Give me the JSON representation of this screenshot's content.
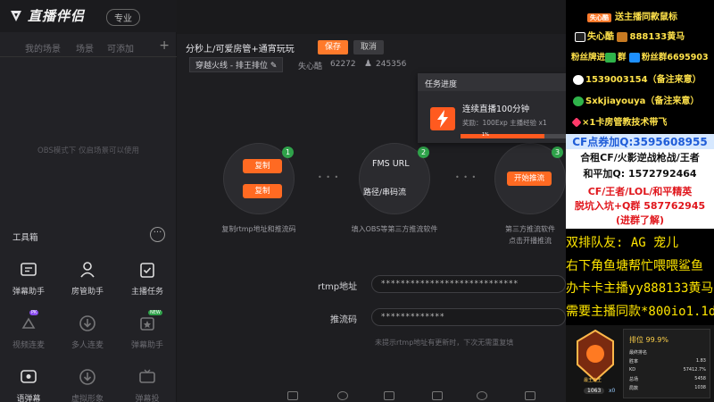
{
  "app": {
    "logo_text": "直播伴侣",
    "badge": "专业",
    "accent": "#ff6a22"
  },
  "scene_tabs": [
    "我的场景",
    "场景",
    "可添加"
  ],
  "obs_hint": "OBS模式下 仅启场景可以使用",
  "toolbox": {
    "title": "工具箱",
    "more_icon": "ellipsis-icon",
    "tools": [
      {
        "label": "弹幕助手",
        "icon": "danmu-icon",
        "badge": "",
        "enabled": true
      },
      {
        "label": "房管助手",
        "icon": "admin-icon",
        "badge": "",
        "enabled": true
      },
      {
        "label": "主播任务",
        "icon": "task-icon",
        "badge": "",
        "enabled": true
      },
      {
        "label": "视频连麦",
        "icon": "video-link-icon",
        "badge": "PK",
        "enabled": false
      },
      {
        "label": "多人连麦",
        "icon": "download-icon",
        "badge": "",
        "enabled": false
      },
      {
        "label": "弹幕助手",
        "icon": "star-icon",
        "badge": "NEW",
        "enabled": false
      },
      {
        "label": "语弹幕",
        "icon": "voice-danmu-icon",
        "badge": "",
        "enabled": true
      },
      {
        "label": "虚拟形象",
        "icon": "download-icon",
        "badge": "",
        "enabled": false
      },
      {
        "label": "弹幕投",
        "icon": "tv-icon",
        "badge": "",
        "enabled": false
      }
    ]
  },
  "stream": {
    "title": "分秒上/可爱房管+通宵玩玩",
    "save_label": "保存",
    "cancel_label": "取消",
    "category": "穿越火线 - 排王排位",
    "user_name": "失心酷",
    "user_id": "62272",
    "viewer_count": "245356"
  },
  "task": {
    "header": "任务进度",
    "name": "连续直播100分钟",
    "reward": "奖励：100Exp 主播经验 x1",
    "progress": 0.8,
    "progress_label": "1%"
  },
  "steps": {
    "copy_label": "复制",
    "fms_url": "FMS URL",
    "stream_key_label": "路径/串码流",
    "start_push_label": "开始推流",
    "cap1": "复制rtmp地址和推流码",
    "cap2": "填入OBS等第三方推流软件",
    "cap3a": "第三方推流软件",
    "cap3b": "点击开播推流",
    "nums": [
      "1",
      "2",
      "3"
    ]
  },
  "fields": {
    "rtmp_label": "rtmp地址",
    "rtmp_value": "****************************",
    "key_label": "推流码",
    "key_value": "*************",
    "hint": "未提示rtmp地址有更新时，下次无需重复填"
  },
  "overlay": {
    "line1": "送主播同款鼠标",
    "line1_tag": "失心酷",
    "line2a": "失心酷",
    "line2b": "888133黄马",
    "line3a": "粉丝牌进",
    "line3b": "群",
    "line3c": "粉丝群6695903",
    "line4": "1539003154（备注来意）",
    "line5": "Sxkjiayouya（备注来意）",
    "line6": "×1卡房管教技术带飞",
    "cf1": "CF点券加Q:3595608955",
    "cf2": "合租CF/火影逆战枪战/王者",
    "cf3": "和平加Q: 1572792464",
    "cf4": "CF/王者/LOL/和平精英",
    "cf5": "脱坑入坑+Q群 587762945",
    "cf6": "(进群了解)",
    "y1": "双排队友: AG 宠儿",
    "y2": "右下角鱼塘帮忙喂喂鲨鱼",
    "y3": "办卡卡主播yy888133黄马",
    "y4": "需要主播同款*800io1.1d",
    "card": {
      "title": "最王之王",
      "pct": "排位 99.9%",
      "rank": "1063",
      "stats": [
        {
          "k": "最终排名",
          "v": ""
        },
        {
          "k": "胜率",
          "v": "1.83"
        },
        {
          "k": "KD",
          "v": "57412.7%"
        },
        {
          "k": "总场",
          "v": "5458"
        },
        {
          "k": "局数",
          "v": "1038"
        }
      ],
      "level": "x0"
    }
  }
}
